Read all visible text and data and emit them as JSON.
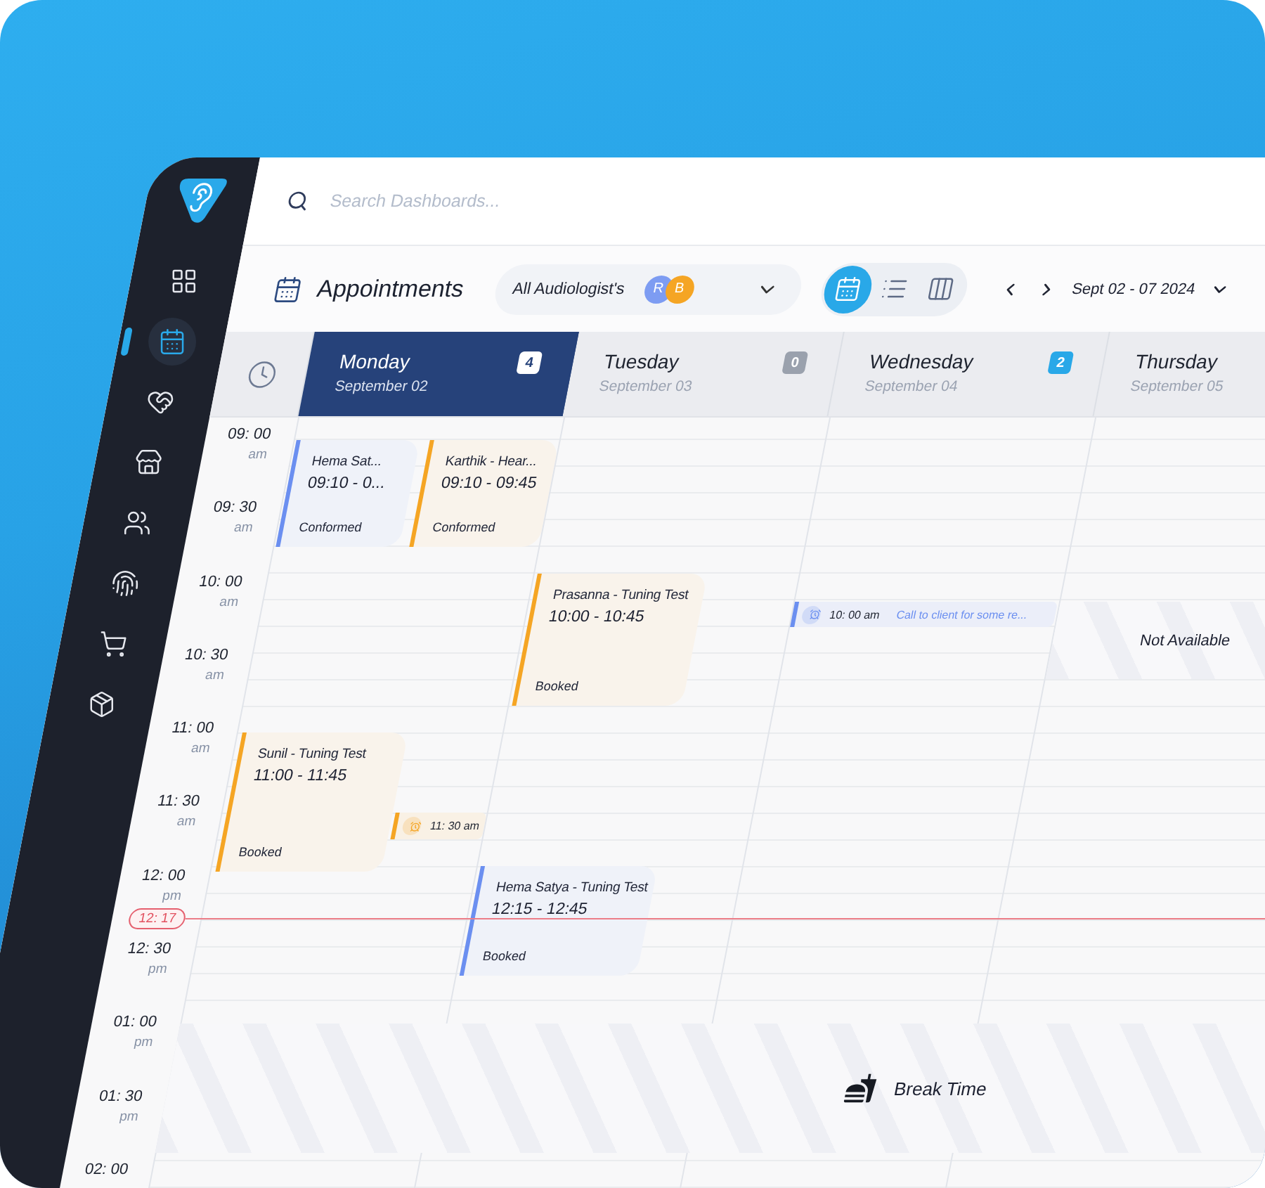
{
  "sidebar": {
    "items": [
      {
        "selected": false
      },
      {
        "selected": true
      },
      {
        "selected": false
      },
      {
        "selected": false
      },
      {
        "selected": false
      },
      {
        "selected": false
      },
      {
        "selected": false
      },
      {
        "selected": false
      }
    ]
  },
  "search": {
    "placeholder": "Search Dashboards..."
  },
  "toolbar": {
    "title": "Appointments",
    "filter": {
      "label": "All Audiologist's",
      "avatars": [
        {
          "initial": "R",
          "color": "#7d9cf2"
        },
        {
          "initial": "B",
          "color": "#f5a524"
        }
      ]
    },
    "views": [
      {
        "selected": true
      },
      {
        "selected": false
      },
      {
        "selected": false
      }
    ],
    "date_range": "Sept 02 - 07 2024"
  },
  "calendar": {
    "days": [
      {
        "name": "Monday",
        "date": "September 02",
        "selected": true,
        "badge": {
          "text": "4",
          "color": "#ffffff"
        },
        "events": [
          {
            "kind": "appointment",
            "title": "Hema Sat...",
            "time": "09:10 - 0...",
            "status": "Conformed",
            "color": "#6b8ff0"
          },
          {
            "kind": "appointment",
            "title": "Karthik - Hear...",
            "time": "09:10 - 09:45",
            "status": "Conformed",
            "color": "#f5a524"
          },
          {
            "kind": "appointment",
            "title": "Sunil - Tuning Test",
            "time": "11:00 - 11:45",
            "status": "Booked",
            "color": "#f5a524"
          },
          {
            "kind": "reminder",
            "time": "11: 30 am",
            "color": "#f5a524"
          }
        ]
      },
      {
        "name": "Tuesday",
        "date": "September 03",
        "selected": false,
        "badge": {
          "text": "0",
          "color": "#9aa1ad"
        },
        "events": [
          {
            "kind": "appointment",
            "title": "Prasanna - Tuning Test",
            "time": "10:00 - 10:45",
            "status": "Booked",
            "color": "#f5a524"
          },
          {
            "kind": "appointment",
            "title": "Hema Satya - Tuning Test",
            "time": "12:15 - 12:45",
            "status": "Booked",
            "color": "#6b8ff0"
          }
        ]
      },
      {
        "name": "Wednesday",
        "date": "September 04",
        "selected": false,
        "badge": {
          "text": "2",
          "color": "#29a8e8"
        },
        "events": [
          {
            "kind": "reminder",
            "time": "10: 00 am",
            "note": "Call to client for some re...",
            "color": "#6b8ff0"
          }
        ]
      },
      {
        "name": "Thursday",
        "date": "September 05",
        "selected": false,
        "events": [
          {
            "kind": "unavailable",
            "label": "Not Available"
          }
        ]
      }
    ],
    "times": [
      {
        "time": "09: 00",
        "period": "am"
      },
      {
        "time": "09: 30",
        "period": "am"
      },
      {
        "time": "10: 00",
        "period": "am"
      },
      {
        "time": "10: 30",
        "period": "am"
      },
      {
        "time": "11: 00",
        "period": "am"
      },
      {
        "time": "11: 30",
        "period": "am"
      },
      {
        "time": "12: 00",
        "period": "pm"
      },
      {
        "time": "12: 30",
        "period": "pm"
      },
      {
        "time": "01: 00",
        "period": "pm"
      },
      {
        "time": "01: 30",
        "period": "pm"
      },
      {
        "time": "02: 00"
      }
    ],
    "current_time": "12: 17",
    "break": {
      "label": "Break Time"
    }
  }
}
